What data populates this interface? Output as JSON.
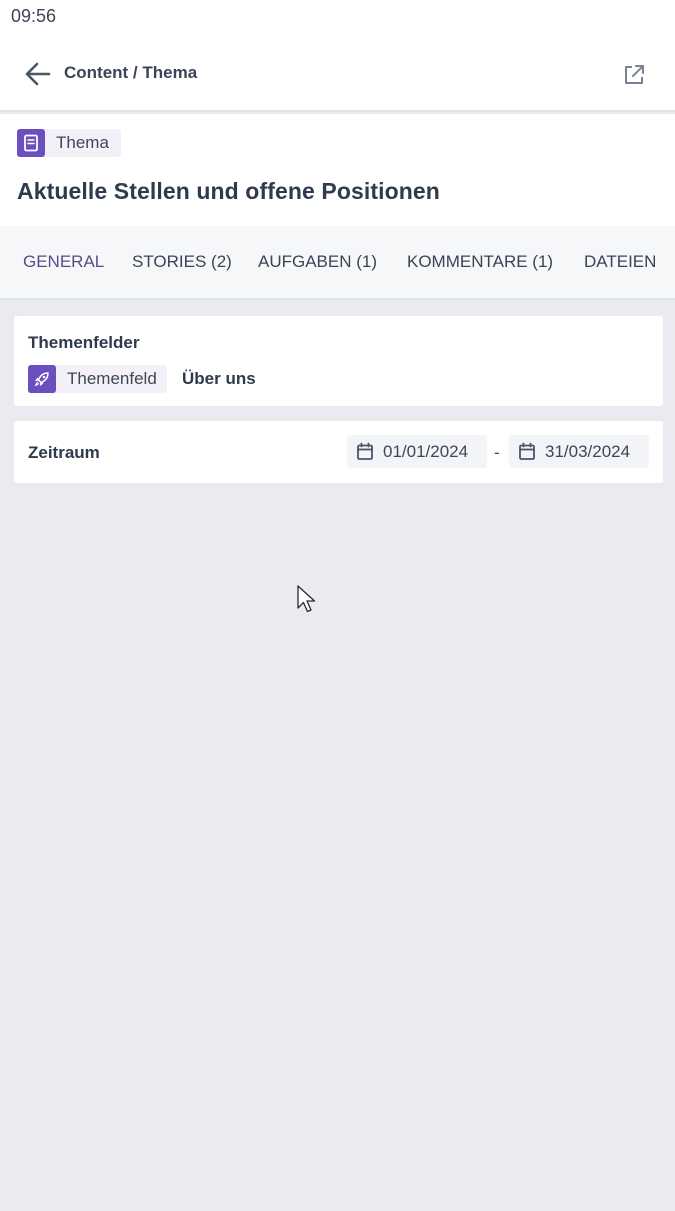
{
  "status_bar": {
    "time": "09:56"
  },
  "header": {
    "back_icon": "arrow-left-icon",
    "breadcrumb": "Content / Thema",
    "external_icon": "external-link-icon"
  },
  "item": {
    "type_label": "Thema",
    "type_icon": "book-icon",
    "title": "Aktuelle Stellen und offene Positionen"
  },
  "tabs": [
    {
      "label": "GENERAL",
      "active": true
    },
    {
      "label": "STORIES (2)"
    },
    {
      "label": "AUFGABEN (1)"
    },
    {
      "label": "KOMMENTARE (1)"
    },
    {
      "label": "DATEIEN"
    }
  ],
  "topics": {
    "label": "Themenfelder",
    "chip_label": "Themenfeld",
    "chip_icon": "rocket-icon",
    "value": "Über uns"
  },
  "period": {
    "label": "Zeitraum",
    "start": "01/01/2024",
    "separator": "-",
    "end": "31/03/2024",
    "calendar_icon": "calendar-icon"
  },
  "colors": {
    "accent": "#6b4fbf",
    "active_tab": "#5a4a8a",
    "background": "#e9ebf0",
    "text": "#2f3a4d"
  }
}
